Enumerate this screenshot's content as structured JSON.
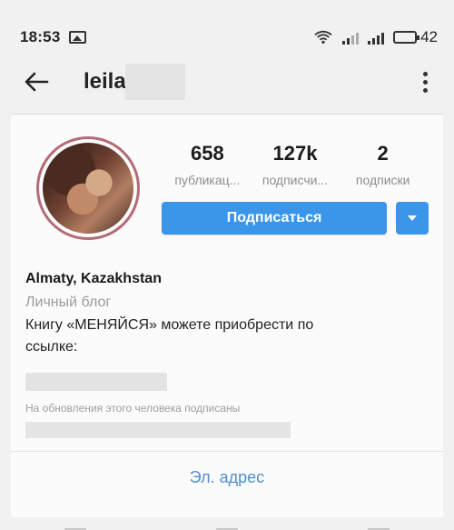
{
  "status_bar": {
    "time": "18:53",
    "battery": "42",
    "icons": [
      "image-icon",
      "wifi-icon",
      "signal-icon",
      "signal-icon",
      "battery-icon"
    ]
  },
  "app_bar": {
    "username": "leila"
  },
  "profile": {
    "stats": [
      {
        "value": "658",
        "label": "публикац..."
      },
      {
        "value": "127k",
        "label": "подписчи..."
      },
      {
        "value": "2",
        "label": "подписки"
      }
    ],
    "subscribe_label": "Подписаться",
    "bio_name": "Almaty, Kazakhstan",
    "bio_category": "Личный блог",
    "bio_text": "Книгу «МЕНЯЙСЯ» можете приобрести по ссылке:",
    "followed_by": "На обновления этого человека подписаны",
    "email_label": "Эл. адрес"
  }
}
